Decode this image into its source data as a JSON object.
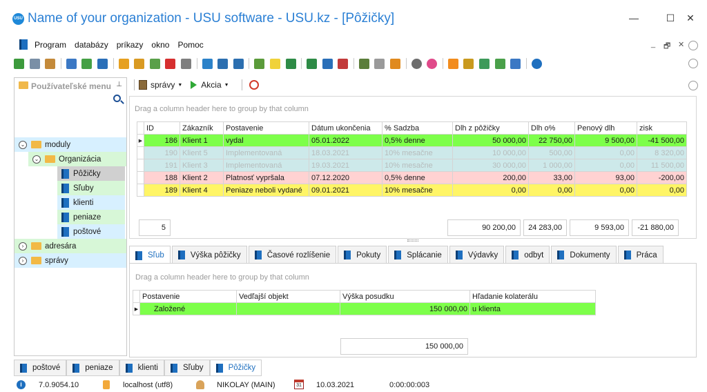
{
  "window": {
    "title": "Name of your organization - USU software - USU.kz - [Pôžičky]",
    "logo_text": "USU",
    "controls": [
      "—",
      "☐",
      "✕"
    ]
  },
  "menu": {
    "items": [
      "Program",
      "databázy",
      "príkazy",
      "okno",
      "Pomoc"
    ],
    "mdi_controls": [
      "_",
      "🗗",
      "✕"
    ]
  },
  "sidebar": {
    "title": "Používateľské menu",
    "tree": [
      {
        "label": "moduly",
        "level": 0,
        "expander": "⌄",
        "type": "folder-open",
        "bg": "#d7f0ff"
      },
      {
        "label": "Organizácia",
        "level": 1,
        "expander": "⌄",
        "type": "folder-open",
        "bg": "#d7f7d7"
      },
      {
        "label": "Pôžičky",
        "level": 2,
        "type": "doc",
        "bg": "#d0d0d0",
        "selected": true
      },
      {
        "label": "Sľuby",
        "level": 2,
        "type": "doc",
        "bg": "#d7f7d7"
      },
      {
        "label": "klienti",
        "level": 2,
        "type": "doc",
        "bg": "#d7f0ff"
      },
      {
        "label": "peniaze",
        "level": 2,
        "type": "doc",
        "bg": "#d7f7d7"
      },
      {
        "label": "poštové",
        "level": 2,
        "type": "doc",
        "bg": "#d7f0ff"
      },
      {
        "label": "adresára",
        "level": 0,
        "expander": "›",
        "type": "folder",
        "bg": "#d7f7d7"
      },
      {
        "label": "správy",
        "level": 0,
        "expander": "›",
        "type": "folder",
        "bg": "#d7f0ff"
      }
    ]
  },
  "module_toolbar": {
    "reports_label": "správy",
    "action_label": "Akcia"
  },
  "grid": {
    "group_hint": "Drag a column header here to group by that column",
    "columns": [
      "ID",
      "Zákazník",
      "Postavenie",
      "Dátum ukončenia",
      "% Sadzba",
      "Dlh z pôžičky",
      "Dlh o%",
      "Penový dlh",
      "zisk"
    ],
    "rows": [
      {
        "style": "g",
        "selected": true,
        "cells": [
          "186",
          "Klient 1",
          "vydal",
          "05.01.2022",
          "0,5% denne",
          "50 000,00",
          "22 750,00",
          "9 500,00",
          "-41 500,00"
        ]
      },
      {
        "style": "c",
        "cells": [
          "190",
          "Klient 5",
          "Implementovaná",
          "18.03.2021",
          "10% mesačne",
          "10 000,00",
          "500,00",
          "0,00",
          "8 320,00"
        ]
      },
      {
        "style": "c",
        "cells": [
          "191",
          "Klient 3",
          "Implementovaná",
          "19.03.2021",
          "10% mesačne",
          "30 000,00",
          "1 000,00",
          "0,00",
          "11 500,00"
        ]
      },
      {
        "style": "p",
        "cells": [
          "188",
          "Klient 2",
          "Platnosť vypršala",
          "07.12.2020",
          "0,5% denne",
          "200,00",
          "33,00",
          "93,00",
          "-200,00"
        ]
      },
      {
        "style": "y",
        "cells": [
          "189",
          "Klient 4",
          "Peniaze neboli vydané",
          "09.01.2021",
          "10% mesačne",
          "0,00",
          "0,00",
          "0,00",
          "0,00"
        ]
      }
    ],
    "footer": {
      "count": "5",
      "dlh_z_pozicky": "90 200,00",
      "dlh_o": "24 283,00",
      "penovy_dlh": "9 593,00",
      "zisk": "-21 880,00"
    }
  },
  "detail_tabs": [
    "Sľub",
    "Výška pôžičky",
    "Časové rozlíšenie",
    "Pokuty",
    "Splácanie",
    "Výdavky",
    "odbyt",
    "Dokumenty",
    "Práca"
  ],
  "detail": {
    "group_hint": "Drag a column header here to group by that column",
    "columns": [
      "Postavenie",
      "Vedľajší objekt",
      "Výška posudku",
      "Hľadanie kolaterálu"
    ],
    "rows": [
      {
        "cells": [
          "Založené",
          "",
          "150 000,00",
          "u klienta"
        ]
      }
    ],
    "footer_total": "150 000,00"
  },
  "bottom_tabs": [
    "poštové",
    "peniaze",
    "klienti",
    "Sľuby",
    "Pôžičky"
  ],
  "status": {
    "version": "7.0.9054.10",
    "database": "localhost (utf8)",
    "user": "NIKOLAY (MAIN)",
    "date": "10.03.2021",
    "timer": "0:00:00:003",
    "calendar_day": "31"
  },
  "colors": {
    "accent": "#1e6fbf",
    "title": "#2a7fd4",
    "row_green": "#7dff4a",
    "row_cyan": "#cde9ea",
    "row_pink": "#ffd2d2",
    "row_yellow": "#fff566"
  },
  "toolbar_icons": [
    "refresh-icon",
    "copy-icon",
    "edit-icon",
    "delete-icon",
    "sync-icon",
    "search-icon",
    "filter-icon",
    "filter-clear-icon",
    "filter-apply-icon",
    "flag-icon",
    "image-icon",
    "insert-icon",
    "expand-icon",
    "collapse-icon",
    "add-row-icon",
    "note-icon",
    "export-excel-icon",
    "import-excel-icon",
    "new-window-icon",
    "close-window-icon",
    "exit-icon",
    "arrow-circle-icon",
    "pin-icon",
    "settings-icon",
    "palette-icon",
    "rss-icon",
    "lock-icon",
    "users-icon",
    "user-group-icon",
    "tool-icon",
    "info-icon"
  ]
}
